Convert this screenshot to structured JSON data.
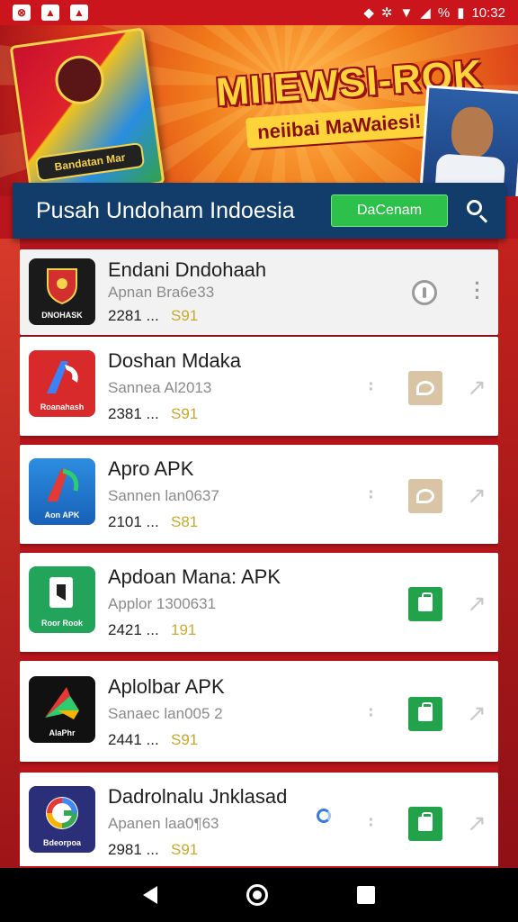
{
  "status_bar": {
    "time": "10:32",
    "battery_label": "%",
    "left_icons": [
      "notification-icon",
      "image-icon",
      "photo-icon"
    ],
    "right_icons": [
      "shield-icon",
      "vibrate-icon",
      "wifi-icon",
      "signal-icon",
      "battery-icon"
    ]
  },
  "banner": {
    "title": "MIIEWSI-ROK",
    "subtitle": "neiibai MaWaiesi!",
    "box_pill": "Bandatan Mar"
  },
  "header": {
    "title": "Pusah Undoham Indoesia",
    "action_label": "DaCenam",
    "search_icon": "search-icon"
  },
  "colors": {
    "header_bg": "#123d6a",
    "action_green": "#2dc04b",
    "rating_gold": "#c9a92a",
    "download_green": "#22a24a",
    "pending_tan": "#d9c4a5"
  },
  "apps": [
    {
      "name": "Endani Dndohaah",
      "meta": "Apnan Bra6e33",
      "size": "2281 ...",
      "rating": "S91",
      "icon_caption": "DNOHASK",
      "icon": "shield-app-icon",
      "action": "info"
    },
    {
      "name": "Doshan Mdaka",
      "meta": "Sannea Al2013",
      "size": "2381 ...",
      "rating": "S91",
      "icon_caption": "Roanahash",
      "icon": "letter-a-app-icon",
      "action": "pending"
    },
    {
      "name": "Apro APK",
      "meta": "Sannen lan0637",
      "size": "2101 ...",
      "rating": "S81",
      "icon_caption": "Aon APK",
      "icon": "letter-a-blue-app-icon",
      "action": "pending"
    },
    {
      "name": "Apdoan Mana: APK",
      "meta": "Applor 1300631",
      "size": "2421 ...",
      "rating": "191",
      "icon_caption": "Roor Rook",
      "icon": "document-app-icon",
      "action": "download"
    },
    {
      "name": "Aplolbar APK",
      "meta": "Sanaec lan005 2",
      "size": "2441 ...",
      "rating": "S91",
      "icon_caption": "AlaPhr",
      "icon": "triangle-app-icon",
      "action": "download"
    },
    {
      "name": "Dadrolnalu Jnklasad",
      "meta": "Apanen laa0¶63",
      "size": "2981 ...",
      "rating": "S91",
      "icon_caption": "Bdeorpoa",
      "icon": "g-app-icon",
      "action": "download"
    }
  ],
  "nav": {
    "back_icon": "back-icon",
    "home_icon": "home-icon",
    "recent_icon": "recent-apps-icon"
  }
}
